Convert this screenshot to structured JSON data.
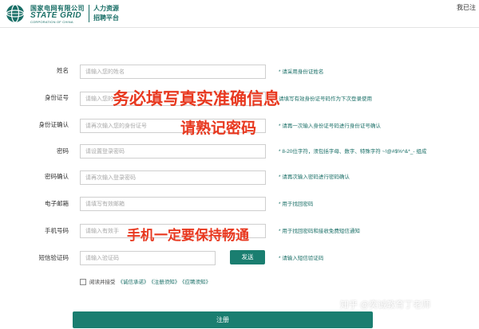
{
  "header": {
    "logo_cn": "国家电网有限公司",
    "logo_en": "STATE GRID",
    "logo_sub": "CORPORATION OF CHINA",
    "portal_line1": "人力资源",
    "portal_line2": "招聘平台",
    "user_name": "我已注"
  },
  "form": {
    "fields": [
      {
        "label": "姓名",
        "placeholder": "请输入您的姓名",
        "hint": "* 请采用身份证姓名"
      },
      {
        "label": "身份证号",
        "placeholder": "请输入您的",
        "hint": "请填写有效身份证号码作为下次登录使用"
      },
      {
        "label": "身份证确认",
        "placeholder": "请再次输入您的身份证号",
        "hint": "* 请再一次输入身份证号码进行身份证号确认"
      },
      {
        "label": "密码",
        "placeholder": "请设置登录密码",
        "hint": "* 8-20位字符，须包括字母、数字、特殊字符 ~!@#$%^&*_- 组成"
      },
      {
        "label": "密码确认",
        "placeholder": "请再次输入登录密码",
        "hint": "* 请再次输入密码进行密码确认"
      },
      {
        "label": "电子邮箱",
        "placeholder": "请填写有效邮箱",
        "hint": "* 用于找回密码"
      },
      {
        "label": "手机号码",
        "placeholder": "请输入有效手",
        "hint": "* 用于找回密码和接收免费短信通知"
      },
      {
        "label": "短信验证码",
        "placeholder": "请输入验证码",
        "hint": "* 请输入短信验证码"
      }
    ],
    "send_label": "发送",
    "agree_text": "阅读并接受",
    "agree_links": [
      "《诚信承诺》",
      "《注册须知》",
      "《应聘须知》"
    ],
    "register_label": "注册"
  },
  "overlays": {
    "line1": "务必填写真实准确信息",
    "line2": "请熟记密码",
    "line3": "手机一定要保持畅通"
  },
  "watermark": "知乎 @奕诚教育丁老师",
  "colors": {
    "brand": "#1a6f67",
    "button": "#1a7e70",
    "overlay_red": "#e8381f"
  }
}
